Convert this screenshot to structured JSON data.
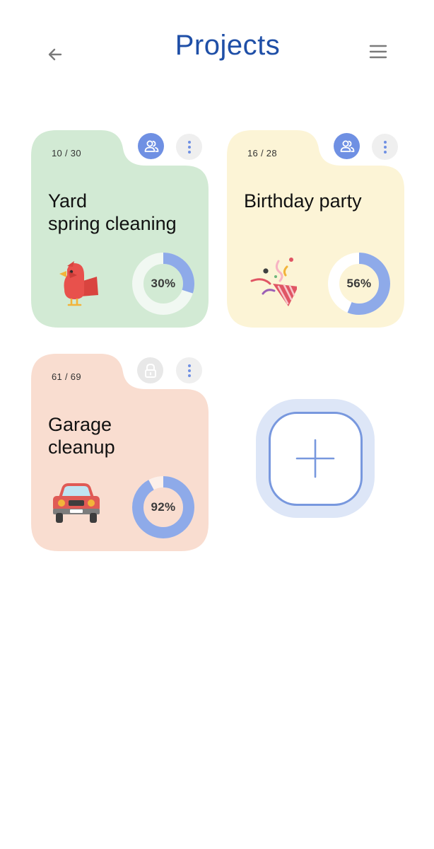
{
  "header": {
    "title": "Projects",
    "back_icon": "arrow-left-icon",
    "menu_icon": "hamburger-menu-icon"
  },
  "colors": {
    "title": "#1f4fa7",
    "accent": "#7898de",
    "progress": "#8eaae9",
    "card_green": "#d2ead4",
    "card_yellow": "#fcf4d6",
    "card_peach": "#f9ddd0"
  },
  "projects": [
    {
      "count": "10 / 30",
      "title": "Yard\nspring cleaning",
      "progress_label": "30%",
      "progress": 0.3,
      "badge_icon": "people-icon",
      "more_icon": "more-vertical-icon",
      "illustration": "bird-icon",
      "color": "#d2ead4",
      "track_color": "#f1f8f2"
    },
    {
      "count": "16 / 28",
      "title": "Birthday party",
      "progress_label": "56%",
      "progress": 0.56,
      "badge_icon": "people-icon",
      "more_icon": "more-vertical-icon",
      "illustration": "party-popper-icon",
      "color": "#fcf4d6",
      "track_color": "#ffffff"
    },
    {
      "count": "61 / 69",
      "title": "Garage\ncleanup",
      "progress_label": "92%",
      "progress": 0.92,
      "badge_icon": "lock-icon",
      "more_icon": "more-vertical-icon",
      "illustration": "car-icon",
      "color": "#f9ddd0",
      "track_color": "#fcf0ea"
    }
  ],
  "add_tile": {
    "icon": "plus-icon"
  }
}
